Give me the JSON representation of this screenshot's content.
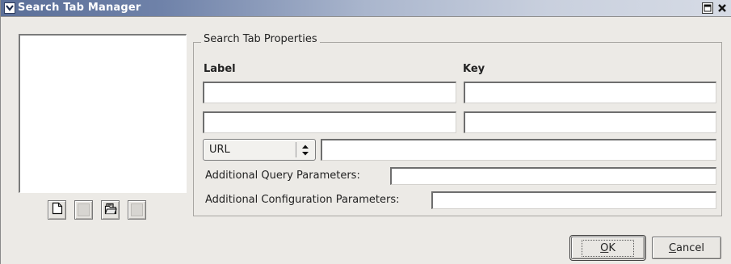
{
  "window": {
    "title": "Search Tab Manager",
    "icons": {
      "menu": "chevron-down-icon",
      "maximize": "maximize-icon",
      "close": "close-icon"
    }
  },
  "left_panel": {
    "toolbar": [
      {
        "name": "new-document-icon",
        "enabled": true
      },
      {
        "name": "blank-icon",
        "enabled": false
      },
      {
        "name": "open-folder-icon",
        "enabled": true
      },
      {
        "name": "blank-icon",
        "enabled": false
      }
    ]
  },
  "properties": {
    "group_title": "Search Tab Properties",
    "label_header": "Label",
    "key_header": "Key",
    "rows": [
      {
        "label_value": "",
        "key_value": ""
      },
      {
        "label_value": "",
        "key_value": ""
      }
    ],
    "type_select": {
      "selected": "URL"
    },
    "url_value": "",
    "additional_query_label": "Additional Query Parameters:",
    "additional_query_value": "",
    "additional_config_label": "Additional Configuration Parameters:",
    "additional_config_value": ""
  },
  "buttons": {
    "ok": {
      "label": "OK",
      "mnemonic": "O"
    },
    "cancel": {
      "label": "Cancel",
      "mnemonic": "C"
    }
  }
}
